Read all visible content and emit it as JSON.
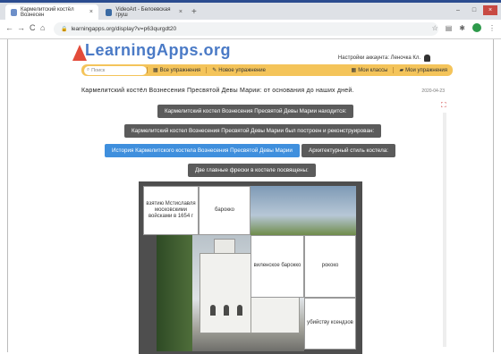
{
  "browser": {
    "tabs": [
      {
        "title": "Кармелитский костёл Вознесен",
        "icon_color": "#6d8fc9"
      },
      {
        "title": "VideoArt - Белоевская груш",
        "icon_color": "#3a6aa3"
      }
    ],
    "new_tab": "+",
    "controls": {
      "minimize": "–",
      "maximize": "□",
      "close": "×"
    },
    "nav": {
      "back": "←",
      "forward": "→",
      "reload": "C",
      "home": "⌂"
    },
    "url": "learningapps.org/display?v=p63qurgdt20"
  },
  "site": {
    "logo": "LearningApps.org",
    "account": "Настройки аккаунта: Леночка Кл.",
    "menu": {
      "search_placeholder": "Поиск",
      "all_exercises": "Все упражнения",
      "new_exercise": "Новое упражнение",
      "my_classes": "Мои классы",
      "my_exercises": "Мои упражнения"
    }
  },
  "exercise": {
    "title": "Кармелитский костёл Вознесения Пресвятой Девы Марии: от основания до наших дней.",
    "date": "2020-04-23",
    "questions": [
      "Кармелитский костел Вознесения Пресвятой Девы Марии находится:",
      "Кармелитский костел Вознесения Пресвятой Девы Марии был построен и реконструирован:",
      "История Кармелитского костела Вознесения Пресвятой Девы Марии",
      "Архитектурный стиль костела:",
      "Две главные фрески в костеле посвящены:"
    ],
    "answers": [
      "взятию Мстиславля московскими войсками в 1654 г",
      "барокко",
      "виленское барокко",
      "рококо",
      "убийству ксендзов"
    ]
  }
}
